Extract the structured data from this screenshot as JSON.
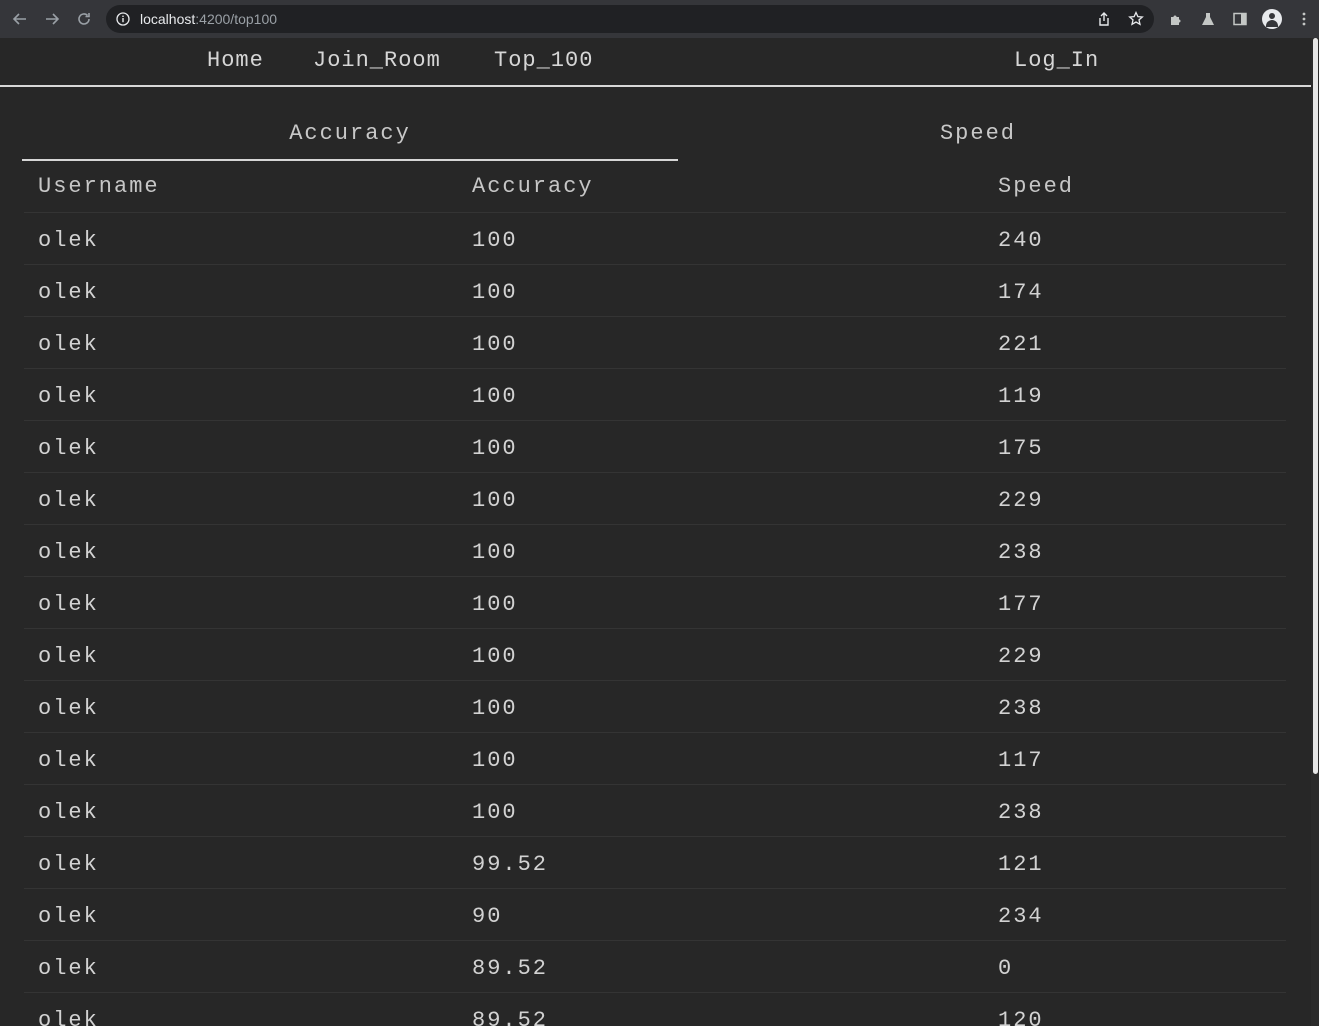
{
  "browser": {
    "url_host": "localhost",
    "url_rest": ":4200/top100"
  },
  "nav": {
    "home": "Home",
    "join_room": "Join_Room",
    "top_100": "Top_100",
    "log_in": "Log_In"
  },
  "tabs": [
    {
      "label": "Accuracy",
      "active": true
    },
    {
      "label": "Speed",
      "active": false
    }
  ],
  "table": {
    "headers": [
      "Username",
      "Accuracy",
      "Speed"
    ],
    "rows": [
      [
        "olek",
        "100",
        "240"
      ],
      [
        "olek",
        "100",
        "174"
      ],
      [
        "olek",
        "100",
        "221"
      ],
      [
        "olek",
        "100",
        "119"
      ],
      [
        "olek",
        "100",
        "175"
      ],
      [
        "olek",
        "100",
        "229"
      ],
      [
        "olek",
        "100",
        "238"
      ],
      [
        "olek",
        "100",
        "177"
      ],
      [
        "olek",
        "100",
        "229"
      ],
      [
        "olek",
        "100",
        "238"
      ],
      [
        "olek",
        "100",
        "117"
      ],
      [
        "olek",
        "100",
        "238"
      ],
      [
        "olek",
        "99.52",
        "121"
      ],
      [
        "olek",
        "90",
        "234"
      ],
      [
        "olek",
        "89.52",
        "0"
      ],
      [
        "olek",
        "89.52",
        "120"
      ]
    ]
  }
}
